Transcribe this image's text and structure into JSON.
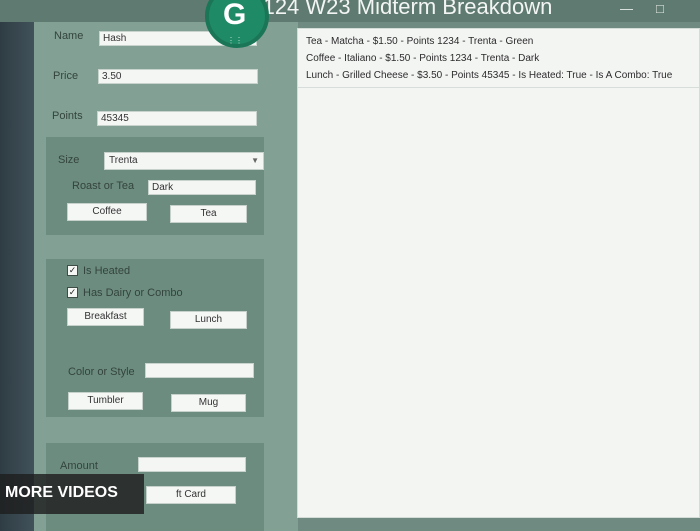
{
  "window": {
    "title": "Prog 124 W23 Midterm Breakdown",
    "min_icon": "minimize-icon",
    "max_icon": "maximize-icon"
  },
  "form": {
    "name_label": "Name",
    "name_value": "Hash",
    "price_label": "Price",
    "price_value": "3.50",
    "points_label": "Points",
    "points_value": "45345"
  },
  "drink_panel": {
    "size_label": "Size",
    "size_selected": "Trenta",
    "roast_label": "Roast or Tea",
    "roast_value": "Dark",
    "coffee_button": "Coffee",
    "tea_button": "Tea"
  },
  "lunch_panel": {
    "heated_label": "Is Heated",
    "heated_checked": true,
    "combo_label": "Has Dairy or Combo",
    "combo_checked": true,
    "breakfast_button": "Breakfast",
    "lunch_button": "Lunch"
  },
  "merch_panel": {
    "color_label": "Color or Style",
    "color_value": "",
    "tumbler_button": "Tumbler",
    "mug_button": "Mug"
  },
  "gift_panel": {
    "amount_label": "Amount",
    "amount_value": "",
    "giftcard_button": "Gift Card",
    "giftcard_visible_text": "ft Card"
  },
  "orders": {
    "items": [
      "Tea - Matcha - $1.50 - Points 1234 - Trenta - Green",
      "Coffee - Italiano - $1.50 - Points 1234 - Trenta - Dark",
      "Lunch - Grilled Cheese - $3.50 - Points 45345 - Is Heated: True - Is A Combo: True"
    ]
  },
  "overlay": {
    "more_videos": "MORE VIDEOS",
    "grammarly_icon": "grammarly-g-icon"
  }
}
